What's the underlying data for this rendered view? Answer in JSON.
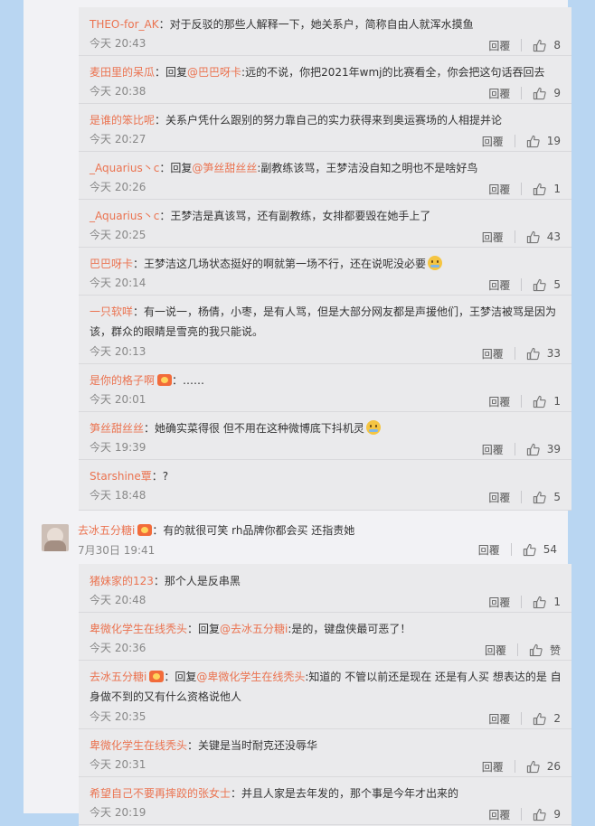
{
  "ui": {
    "reply_label": "回覆"
  },
  "panel1": [
    {
      "user": "THEO-for_AK",
      "text": "：对于反驳的那些人解释一下，她关系户，简称自由人就浑水摸鱼",
      "time": "今天 20:43",
      "likes": "8"
    },
    {
      "user": "麦田里的呆瓜",
      "pre": "：回复",
      "mention": "@巴巴呀卡",
      "text": ":远的不说，你把2021年wmj的比赛看全，你会把这句话吞回去",
      "time": "今天 20:38",
      "likes": "9"
    },
    {
      "user": "是谁的笨比呢",
      "text": "：关系户凭什么跟别的努力靠自己的实力获得来到奥运赛场的人相提并论",
      "time": "今天 20:27",
      "likes": "19"
    },
    {
      "user": "_Aquarius丶c",
      "pre": "：回复",
      "mention": "@笋丝甜丝丝",
      "text": ":副教练该骂，王梦洁没自知之明也不是啥好鸟",
      "time": "今天 20:26",
      "likes": "1"
    },
    {
      "user": "_Aquarius丶c",
      "text": "：王梦洁是真该骂，还有副教练，女排都要毁在她手上了",
      "time": "今天 20:25",
      "likes": "43"
    },
    {
      "user": "巴巴呀卡",
      "text": "：王梦洁这几场状态挺好的啊就第一场不行，还在说呢没必要",
      "emoji": true,
      "time": "今天 20:14",
      "likes": "5"
    },
    {
      "user": "一只软咩",
      "text": "：有一说一，杨倩，小枣，是有人骂，但是大部分网友都是声援他们，王梦洁被骂是因为该，群众的眼睛是雪亮的我只能说。",
      "time": "今天 20:13",
      "likes": "33"
    },
    {
      "user": "是你的格子啊",
      "badge": true,
      "text": "：……",
      "time": "今天 20:01",
      "likes": "1"
    },
    {
      "user": "笋丝甜丝丝",
      "text": "：她确实菜得很 但不用在这种微博底下抖机灵",
      "emoji": true,
      "time": "今天 19:39",
      "likes": "39"
    },
    {
      "user": "Starshine覃",
      "text": "：?",
      "time": "今天 18:48",
      "likes": "5"
    }
  ],
  "top_comment": {
    "user": "去冰五分糖i",
    "text": "：有的就很可笑 rh品牌你都会买 还指责她",
    "time": "7月30日 19:41",
    "likes": "54"
  },
  "panel2": [
    {
      "user": "猪妹家的123",
      "text": "：那个人是反串黑",
      "time": "今天 20:48",
      "likes": "1"
    },
    {
      "user": "卑微化学生在线秃头",
      "pre": "：回复",
      "mention": "@去冰五分糖i",
      "text": ":是的，键盘侠最可恶了！",
      "time": "今天 20:36",
      "likes": "赞"
    },
    {
      "user": "去冰五分糖i",
      "badge": true,
      "pre": "：回复",
      "mention": "@卑微化学生在线秃头",
      "text": ":知道的 不管以前还是现在 还是有人买 想表达的是 自身做不到的又有什么资格说他人",
      "time": "今天 20:35",
      "likes": "2"
    },
    {
      "user": "卑微化学生在线秃头",
      "text": "：关键是当时耐克还没辱华",
      "time": "今天 20:31",
      "likes": "26"
    },
    {
      "user": "希望自己不要再摔跤的张女士",
      "text": "：并且人家是去年发的，那个事是今年才出来的",
      "time": "今天 20:19",
      "likes": "9"
    }
  ]
}
